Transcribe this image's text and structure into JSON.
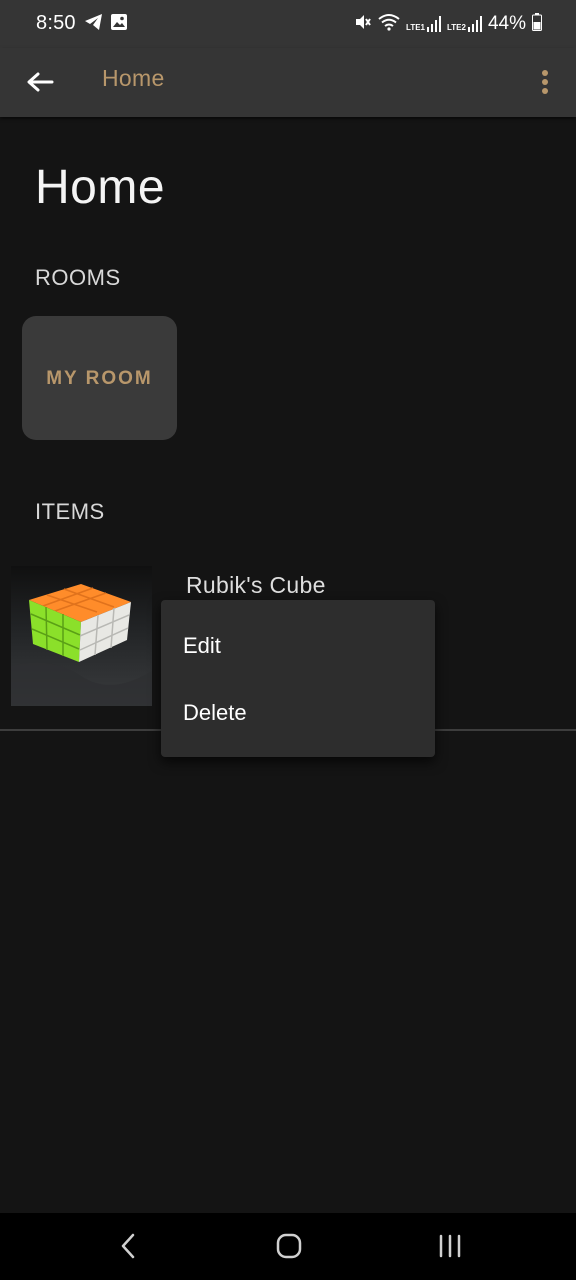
{
  "status_bar": {
    "time": "8:50",
    "left_icons": [
      "telegram-icon",
      "gallery-icon"
    ],
    "right_icons": [
      "mute-icon",
      "wifi-icon",
      "volte-lte1-signal-icon",
      "volte-lte2-signal-icon",
      "battery-icon"
    ],
    "lte1_label": "LTE1",
    "lte2_label": "LTE2",
    "battery_percent": "44%"
  },
  "app_bar": {
    "title": "Home",
    "back_icon": "arrow-left-icon",
    "menu_icon": "more-vertical-icon"
  },
  "page": {
    "title": "Home",
    "rooms_header": "ROOMS",
    "items_header": "ITEMS"
  },
  "rooms": [
    {
      "label": "MY ROOM"
    }
  ],
  "items": [
    {
      "name": "Rubik's Cube",
      "image": "rubiks-cube-photo"
    }
  ],
  "context_menu": {
    "items": [
      {
        "label": "Edit"
      },
      {
        "label": "Delete"
      }
    ]
  },
  "nav_bar": {
    "icons": [
      "nav-back-icon",
      "nav-home-icon",
      "nav-recents-icon"
    ]
  },
  "colors": {
    "accent": "#b8976b",
    "background": "#141414",
    "bar": "#353535",
    "card": "#3a3a3a",
    "menu": "#2d2d2d"
  }
}
